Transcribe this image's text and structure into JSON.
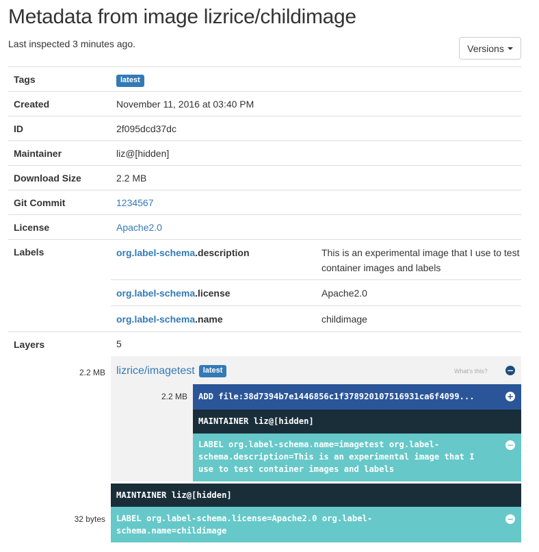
{
  "header": {
    "title": "Metadata from image lizrice/childimage",
    "subtitle": "Last inspected 3 minutes ago.",
    "versions_label": "Versions"
  },
  "fields": {
    "tags": {
      "label": "Tags",
      "badge": "latest"
    },
    "created": {
      "label": "Created",
      "value": "November 11, 2016 at 03:40 PM"
    },
    "id": {
      "label": "ID",
      "value": "2f095dcd37dc"
    },
    "maintainer": {
      "label": "Maintainer",
      "value": "liz@[hidden]"
    },
    "download_size": {
      "label": "Download Size",
      "value": "2.2 MB"
    },
    "git_commit": {
      "label": "Git Commit",
      "value": "1234567"
    },
    "license": {
      "label": "License",
      "value": "Apache2.0"
    },
    "labels": {
      "label": "Labels",
      "items": [
        {
          "key_prefix": "org.label-schema",
          "key_suffix": ".description",
          "value": "This is an experimental image that I use to test container images and labels"
        },
        {
          "key_prefix": "org.label-schema",
          "key_suffix": ".license",
          "value": "Apache2.0"
        },
        {
          "key_prefix": "org.label-schema",
          "key_suffix": ".name",
          "value": "childimage"
        }
      ]
    },
    "layers": {
      "label": "Layers",
      "value": "5"
    }
  },
  "layers": {
    "base": {
      "size": "2.2 MB",
      "name": "lizrice/imagetest",
      "badge": "latest",
      "whats_this": "What's this?",
      "toggle": "−",
      "commands": [
        {
          "size": "2.2 MB",
          "text": "ADD file:38d7394b7e1446856c1f378920107516931ca6f4099...",
          "toggle": "+"
        },
        {
          "size": "",
          "text": "MAINTAINER liz@[hidden]",
          "toggle": ""
        },
        {
          "size": "",
          "text": "LABEL org.label-schema.name=imagetest org.label-schema.description=This is an experimental image that I use to test container images and labels",
          "toggle": "−"
        }
      ]
    },
    "own": [
      {
        "size": "",
        "text": "MAINTAINER liz@[hidden]",
        "toggle": ""
      },
      {
        "size": "32 bytes",
        "text": "LABEL org.label-schema.license=Apache2.0 org.label-schema.name=childimage",
        "toggle": "−"
      }
    ]
  },
  "colors": {
    "link": "#337ab7",
    "add_layer": "#2a5699",
    "maintainer_layer": "#1a2e3a",
    "label_layer": "#66c8c8",
    "layer_group_bg": "#f2f2f2"
  }
}
